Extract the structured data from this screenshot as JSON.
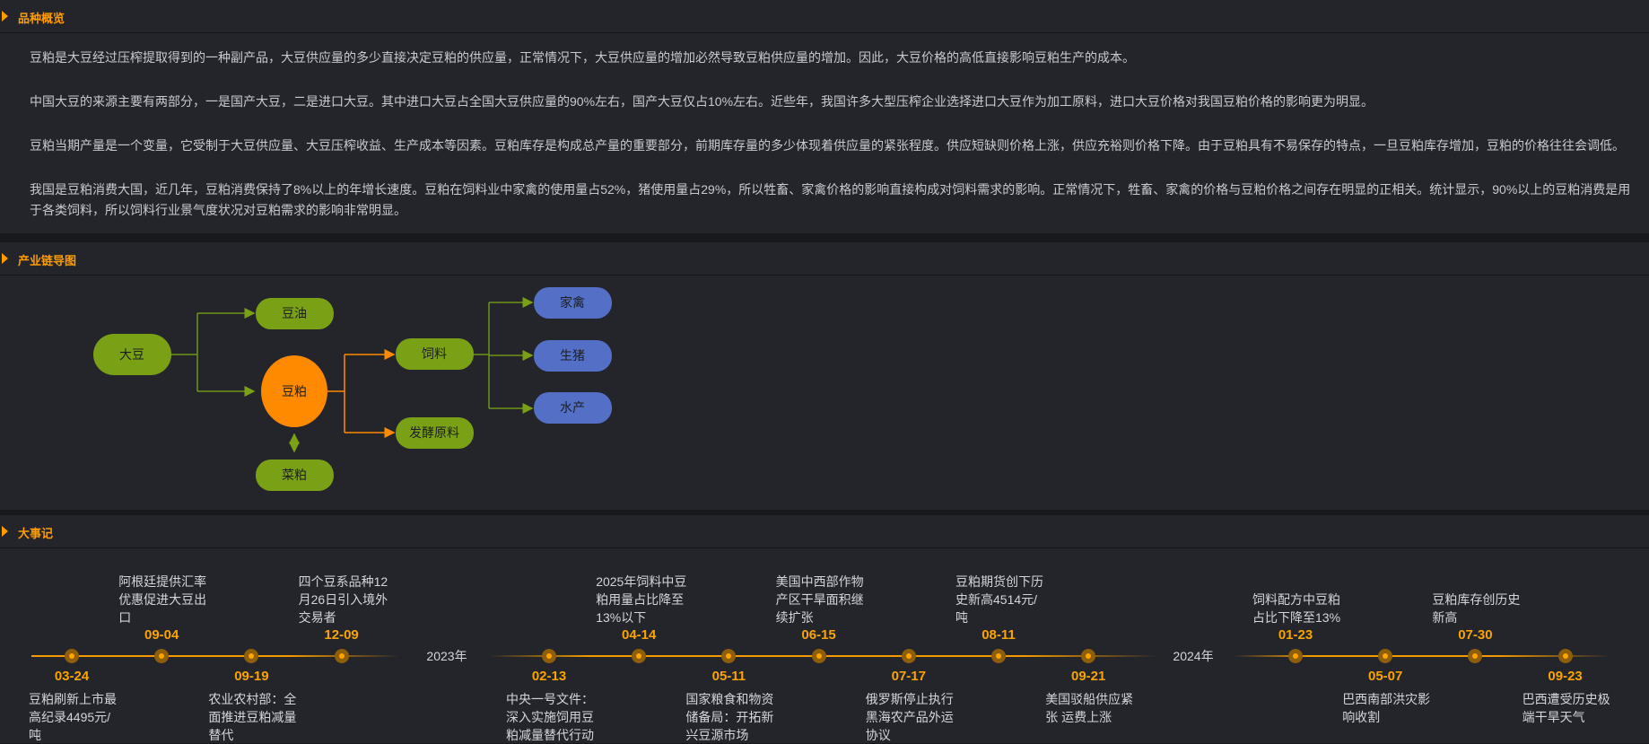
{
  "sections": {
    "overview": {
      "title": "品种概览",
      "paragraphs": [
        "豆粕是大豆经过压榨提取得到的一种副产品，大豆供应量的多少直接决定豆粕的供应量，正常情况下，大豆供应量的增加必然导致豆粕供应量的增加。因此，大豆价格的高低直接影响豆粕生产的成本。",
        "中国大豆的来源主要有两部分，一是国产大豆，二是进口大豆。其中进口大豆占全国大豆供应量的90%左右，国产大豆仅占10%左右。近些年，我国许多大型压榨企业选择进口大豆作为加工原料，进口大豆价格对我国豆粕价格的影响更为明显。",
        "豆粕当期产量是一个变量，它受制于大豆供应量、大豆压榨收益、生产成本等因素。豆粕库存是构成总产量的重要部分，前期库存量的多少体现着供应量的紧张程度。供应短缺则价格上涨，供应充裕则价格下降。由于豆粕具有不易保存的特点，一旦豆粕库存增加，豆粕的价格往往会调低。",
        "我国是豆粕消费大国，近几年，豆粕消费保持了8%以上的年增长速度。豆粕在饲料业中家禽的使用量占52%，猪使用量占29%，所以牲畜、家禽价格的影响直接构成对饲料需求的影响。正常情况下，牲畜、家禽的价格与豆粕价格之间存在明显的正相关。统计显示，90%以上的豆粕消费是用于各类饲料，所以饲料行业景气度状况对豆粕需求的影响非常明显。"
      ]
    },
    "chain": {
      "title": "产业链导图",
      "nodes": {
        "soybean": "大豆",
        "soy_oil": "豆油",
        "soy_meal": "豆粕",
        "rapeseed_meal": "菜粕",
        "feed": "饲料",
        "fermentation": "发酵原料",
        "poultry": "家禽",
        "hog": "生猪",
        "aquaculture": "水产"
      },
      "colors": {
        "green": "#7aa116",
        "orange": "#ff8a00",
        "blue": "#5470c6"
      }
    },
    "events": {
      "title": "大事记",
      "groups": [
        {
          "events": [
            {
              "date": "03-24",
              "pos": "bot",
              "text": "豆粕刷新上市最高纪录4495元/吨"
            },
            {
              "date": "09-04",
              "pos": "top",
              "text": "阿根廷提供汇率优惠促进大豆出口"
            },
            {
              "date": "09-19",
              "pos": "bot",
              "text": "农业农村部：全面推进豆粕减量替代"
            },
            {
              "date": "12-09",
              "pos": "top",
              "text": "四个豆系品种12月26日引入境外交易者"
            }
          ]
        },
        {
          "year": "2023年",
          "events": [
            {
              "date": "02-13",
              "pos": "bot",
              "text": "中央一号文件：深入实施饲用豆粕减量替代行动"
            },
            {
              "date": "04-14",
              "pos": "top",
              "text": "2025年饲料中豆粕用量占比降至13%以下"
            },
            {
              "date": "05-11",
              "pos": "bot",
              "text": "国家粮食和物资储备局：开拓新兴豆源市场"
            },
            {
              "date": "06-15",
              "pos": "top",
              "text": "美国中西部作物产区干旱面积继续扩张"
            },
            {
              "date": "07-17",
              "pos": "bot",
              "text": "俄罗斯停止执行黑海农产品外运协议"
            },
            {
              "date": "08-11",
              "pos": "top",
              "text": "豆粕期货创下历史新高4514元/吨"
            },
            {
              "date": "09-21",
              "pos": "bot",
              "text": "美国驳船供应紧张 运费上涨"
            }
          ]
        },
        {
          "year": "2024年",
          "events": [
            {
              "date": "01-23",
              "pos": "top",
              "text": "饲料配方中豆粕占比下降至13%"
            },
            {
              "date": "05-07",
              "pos": "bot",
              "text": "巴西南部洪灾影响收割"
            },
            {
              "date": "07-30",
              "pos": "top",
              "text": "豆粕库存创历史新高"
            },
            {
              "date": "09-23",
              "pos": "bot",
              "text": "巴西遭受历史极端干旱天气"
            }
          ]
        }
      ]
    }
  }
}
